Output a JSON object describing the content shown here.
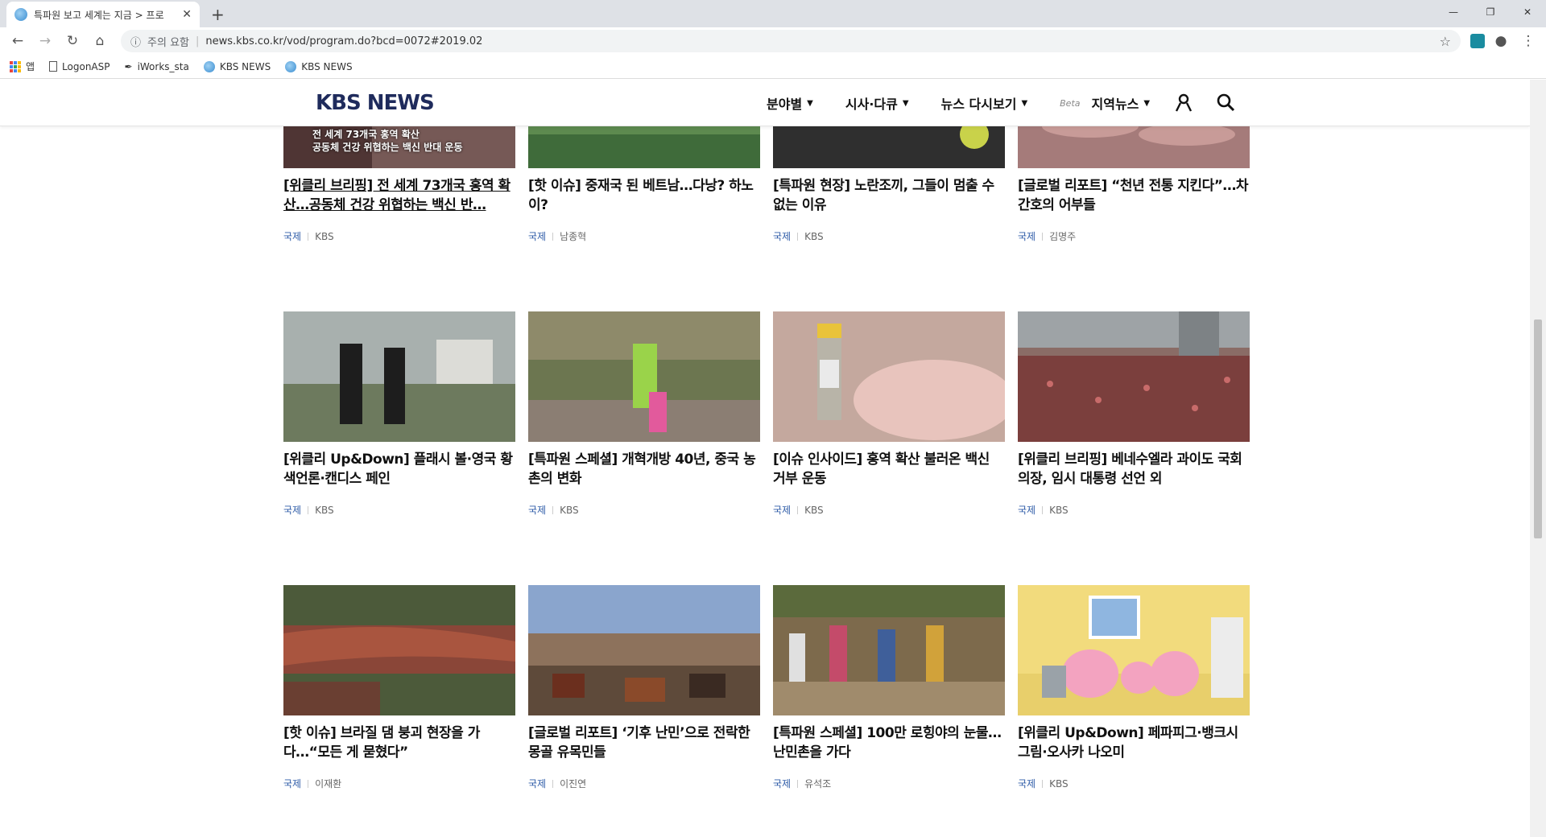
{
  "browser": {
    "tab_title": "특파원 보고 세계는 지금 > 프로",
    "tab_close": "✕",
    "new_tab": "+",
    "security_label": "주의 요함",
    "url": "news.kbs.co.kr/vod/program.do?bcd=0072#2019.02",
    "bookmarks": [
      {
        "label": "앱",
        "icon": "apps-icon"
      },
      {
        "label": "LogonASP",
        "icon": "page-icon"
      },
      {
        "label": "iWorks_sta",
        "icon": "tool-icon"
      },
      {
        "label": "KBS NEWS",
        "icon": "kbs-globe-icon"
      },
      {
        "label": "KBS NEWS",
        "icon": "kbs-globe-icon"
      }
    ]
  },
  "header": {
    "logo": "KBS NEWS",
    "menu": [
      {
        "label": "분야별"
      },
      {
        "label": "시사·다큐"
      },
      {
        "label": "뉴스 다시보기"
      },
      {
        "label": "지역뉴스",
        "badge": "Beta"
      }
    ]
  },
  "cards": [
    {
      "title": "[위클리 브리핑] 전 세계 73개국 홍역 확산…공동체 건강 위협하는 백신 반…",
      "category": "국제",
      "author": "KBS",
      "caption_l1": "전 세계 73개국 홍역 확산",
      "caption_l2": "공동체 건강 위협하는 백신 반대 운동"
    },
    {
      "title": "[핫 이슈] 중재국 된 베트남…다낭? 하노이?",
      "category": "국제",
      "author": "남종혁"
    },
    {
      "title": "[특파원 현장] 노란조끼, 그들이 멈출 수 없는 이유",
      "category": "국제",
      "author": "KBS"
    },
    {
      "title": "[글로벌 리포트] “천년 전통 지킨다”…차간호의 어부들",
      "category": "국제",
      "author": "김명주"
    },
    {
      "title": "[위클리 Up&Down] 플래시 볼·영국 황색언론·캔디스 페인",
      "category": "국제",
      "author": "KBS"
    },
    {
      "title": "[특파원 스페셜] 개혁개방 40년, 중국 농촌의 변화",
      "category": "국제",
      "author": "KBS"
    },
    {
      "title": "[이슈 인사이드] 홍역 확산 불러온 백신 거부 운동",
      "category": "국제",
      "author": "KBS"
    },
    {
      "title": "[위클리 브리핑] 베네수엘라 과이도 국회의장, 임시 대통령 선언 외",
      "category": "국제",
      "author": "KBS"
    },
    {
      "title": "[핫 이슈] 브라질 댐 붕괴 현장을 가다…“모든 게 묻혔다”",
      "category": "국제",
      "author": "이재환"
    },
    {
      "title": "[글로벌 리포트] ‘기후 난민’으로 전락한 몽골 유목민들",
      "category": "국제",
      "author": "이진연"
    },
    {
      "title": "[특파원 스페셜] 100만 로힝야의 눈물…난민촌을 가다",
      "category": "국제",
      "author": "유석조"
    },
    {
      "title": "[위클리 Up&Down] 페파피그·뱅크시 그림·오사카 나오미",
      "category": "국제",
      "author": "KBS"
    }
  ]
}
